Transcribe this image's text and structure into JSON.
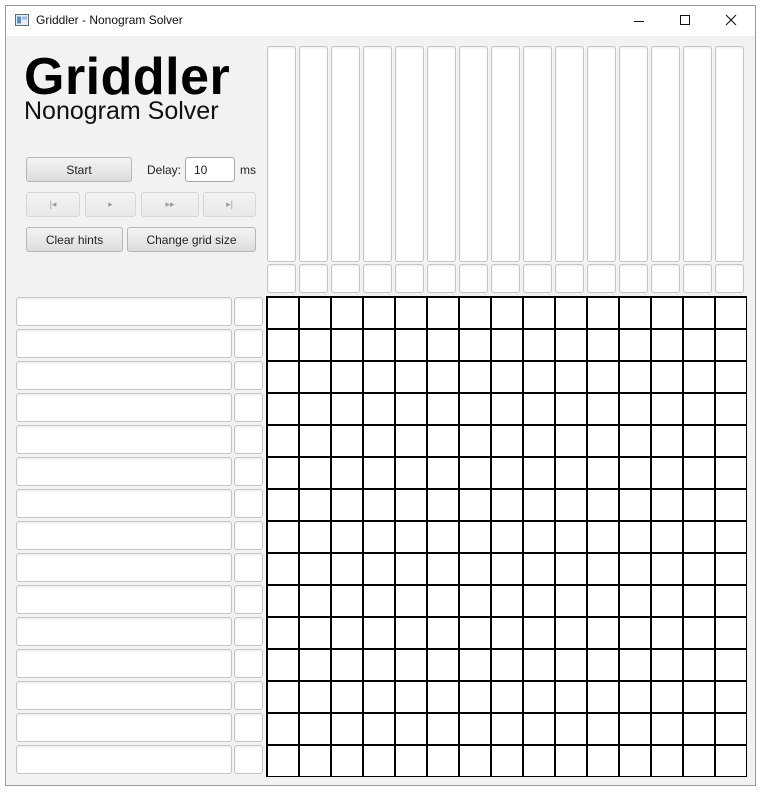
{
  "window": {
    "title": "Griddler - Nonogram Solver"
  },
  "header": {
    "logo": "Griddler",
    "subtitle": "Nonogram Solver"
  },
  "controls": {
    "start_label": "Start",
    "delay_label": "Delay:",
    "delay_value": "10",
    "delay_unit": "ms",
    "first_label": "|◂",
    "play_label": "▸",
    "fast_label": "▸▸",
    "last_label": "▸|",
    "clear_hints_label": "Clear hints",
    "change_grid_label": "Change grid size"
  },
  "grid": {
    "rows": 15,
    "columns": 15
  }
}
